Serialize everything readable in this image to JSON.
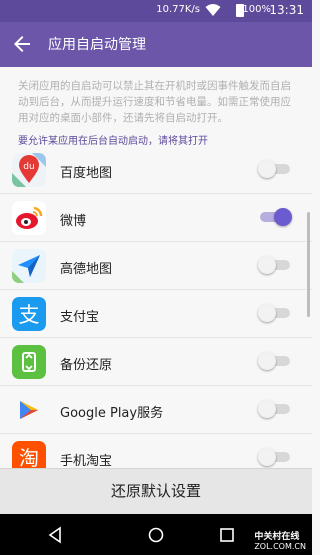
{
  "status_bar": {
    "speed": "10.77K/s",
    "battery": "100%",
    "time": "13:31"
  },
  "app_bar": {
    "title": "应用自启动管理",
    "back_icon": "arrow-left-icon"
  },
  "description": "关闭应用的自启动可以禁止其在开机时或因事件触发而自启动到后台，从而提升运行速度和节省电量。如需正常使用应用对应的桌面小部件，还请先将自启动打开。",
  "section_header": "要允许某应用在后台自动启动，请将其打开",
  "apps": [
    {
      "name": "百度地图",
      "icon": "baidu-maps-icon",
      "enabled": false
    },
    {
      "name": "微博",
      "icon": "weibo-icon",
      "enabled": true
    },
    {
      "name": "高德地图",
      "icon": "amap-icon",
      "enabled": false
    },
    {
      "name": "支付宝",
      "icon": "alipay-icon",
      "enabled": false
    },
    {
      "name": "备份还原",
      "icon": "backup-icon",
      "enabled": false
    },
    {
      "name": "Google Play服务",
      "icon": "google-play-services-icon",
      "enabled": false
    },
    {
      "name": "手机淘宝",
      "icon": "taobao-icon",
      "enabled": false
    }
  ],
  "icon_text": {
    "baidu": "du",
    "alipay": "支",
    "taobao": "淘"
  },
  "reset_button": "还原默认设置",
  "watermark": {
    "brand": "中关村在线",
    "url": "ZOL.COM.CN"
  },
  "colors": {
    "accent": "#6b56a9",
    "toggle_on": "#6a5bd1"
  }
}
